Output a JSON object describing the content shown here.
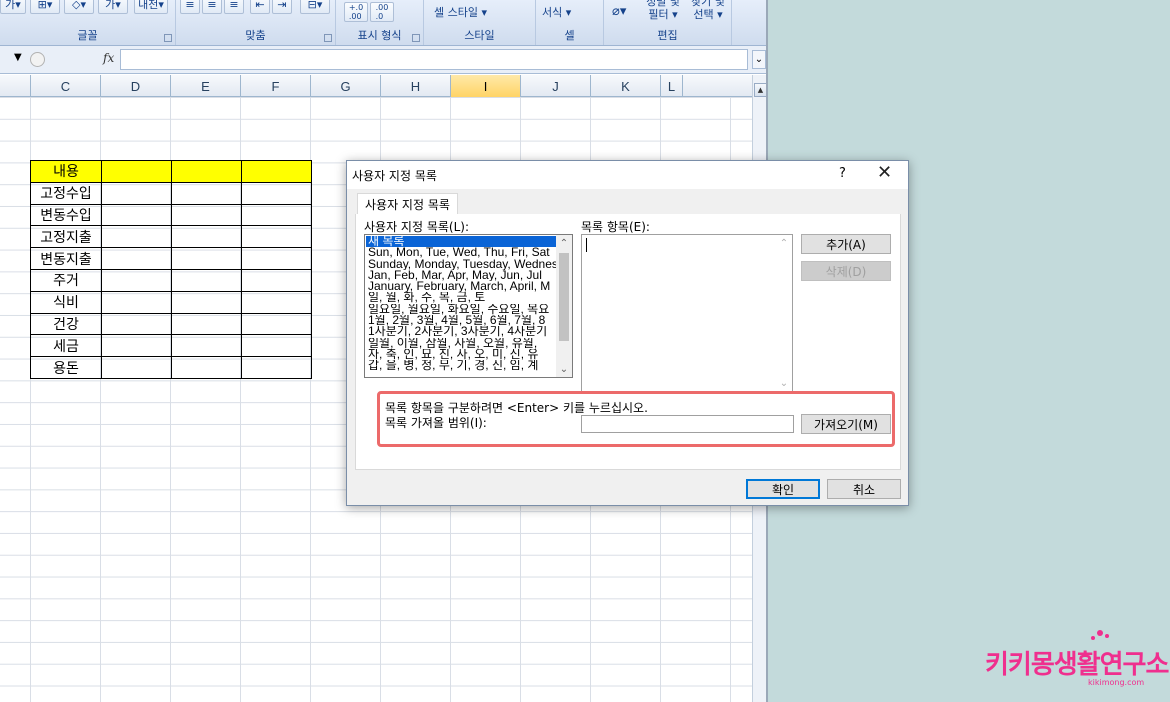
{
  "ribbon": {
    "groups": [
      {
        "label": "글꼴"
      },
      {
        "label": "맞춤"
      },
      {
        "label": "표시 형식"
      },
      {
        "label": "스타일"
      },
      {
        "label": "셀"
      },
      {
        "label": "편집"
      }
    ],
    "styles_label": "셀 스타일 ▾",
    "format_label": "서식 ▾",
    "sort_filter_label": "정렬 및 필터 ▾",
    "find_select_label": "찾기 및 선택 ▾",
    "decimal_increase": "+.0 .00",
    "decimal_decrease": ".00 →.0"
  },
  "formula_bar": {
    "fx_label": "fx",
    "value": ""
  },
  "sheet": {
    "columns": [
      "C",
      "D",
      "E",
      "F",
      "G",
      "H",
      "I",
      "J",
      "K",
      "L"
    ],
    "active_column": "I",
    "table": {
      "header": "내용",
      "rows": [
        "고정수입",
        "변동수입",
        "고정지출",
        "변동지출",
        "주거",
        "식비",
        "건강",
        "세금",
        "용돈"
      ]
    }
  },
  "dialog": {
    "title": "사용자 지정 목록",
    "help": "?",
    "close": "✕",
    "tab_label": "사용자 지정 목록",
    "lists_label": "사용자 지정 목록(L):",
    "entries_label": "목록 항목(E):",
    "lists": [
      "새 목록",
      "Sun, Mon, Tue, Wed, Thu, Fri, Sat",
      "Sunday, Monday, Tuesday, Wednesday",
      "Jan, Feb, Mar, Apr, May, Jun, Jul",
      "January, February, March, April, M",
      "일, 월, 화, 수, 목, 금, 토",
      "일요일, 월요일, 화요일, 수요일, 목요",
      "1월, 2월, 3월, 4월, 5월, 6월, 7월, 8",
      "1사분기, 2사분기, 3사분기, 4사분기",
      "일월, 이월, 삼월, 사월, 오월, 유월,",
      "자, 축, 인, 묘, 진, 사, 오, 미, 신, 유",
      "갑, 을, 병, 정, 무, 기, 경, 신, 임, 계"
    ],
    "add_button": "추가(A)",
    "delete_button": "삭제(D)",
    "hint_text": "목록 항목을 구분하려면 <Enter> 키를 누르십시오.",
    "import_label": "목록 가져올 범위(I):",
    "import_value": "",
    "import_button": "가져오기(M)",
    "ok_button": "확인",
    "cancel_button": "취소"
  },
  "watermark": {
    "main": "키키몽생활연구소",
    "sub": "kikimong.com"
  }
}
